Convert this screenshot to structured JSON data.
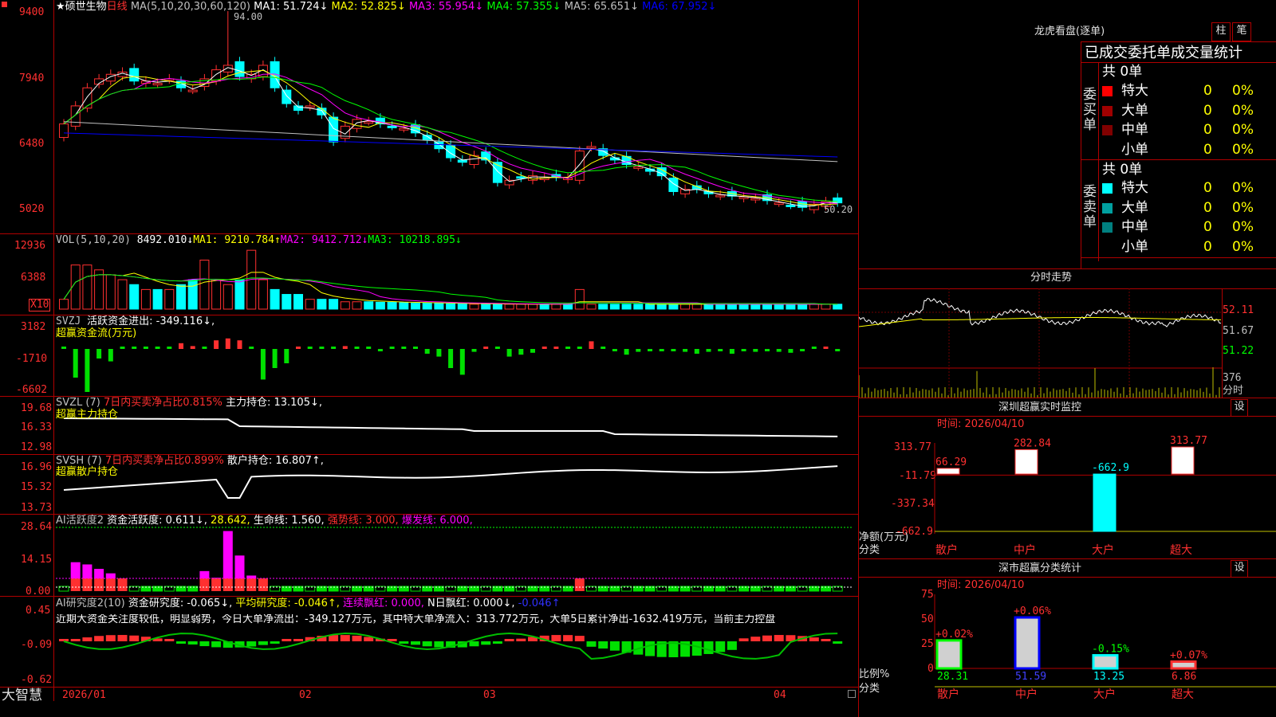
{
  "header": {
    "marker": "★",
    "stock_name": "硕世生物",
    "period": "日线",
    "ma_label": "MA(5,10,20,30,60,120)",
    "ma_values": [
      {
        "label": "MA1: 51.724↓",
        "color": "#ffffff"
      },
      {
        "label": "MA2: 52.825↓",
        "color": "#ffff00"
      },
      {
        "label": "MA3: 55.954↓",
        "color": "#ff00ff"
      },
      {
        "label": "MA4: 57.355↓",
        "color": "#00ff00"
      },
      {
        "label": "MA5: 65.651↓",
        "color": "#c0c0c0"
      },
      {
        "label": "MA6: 67.952↓",
        "color": "#0000ff"
      }
    ],
    "high_mark": "94.00",
    "low_mark": "50.20"
  },
  "price_axis": [
    "9400",
    "7940",
    "6480",
    "5020"
  ],
  "vol_panel": {
    "label": "VOL(5,10,20)",
    "v": "8492.010↓",
    "ma1": "MA1: 9210.784↑",
    "ma2": "MA2: 9412.712↓",
    "ma3": "MA3: 10218.895↓",
    "axis": [
      "12936",
      "6388"
    ],
    "unit": "X10"
  },
  "svzj_panel": {
    "label": "SVZJ",
    "text": "活跃资金进出: -349.116↓,",
    "sub": "超赢资金流(万元)",
    "axis": [
      "3182",
      "-1710",
      "-6602"
    ]
  },
  "svzl_panel": {
    "label": "SVZL (7)",
    "text1": "7日内买卖净占比0.815%",
    "text2": "主力持仓: 13.105↓,",
    "sub": "超赢主力持仓",
    "axis": [
      "19.68",
      "16.33",
      "12.98"
    ]
  },
  "svsh_panel": {
    "label": "SVSH (7)",
    "text1": "7日内买卖净占比0.899%",
    "text2": "散户持仓: 16.807↑,",
    "sub": "超赢散户持仓",
    "axis": [
      "16.96",
      "15.32",
      "13.73"
    ]
  },
  "ai_active_panel": {
    "label": "AI活跃度2",
    "text1": "资金活跃度: 0.611↓,",
    "text2": "28.642,",
    "text3": "生命线: 1.560,",
    "text4": "强势线: 3.000,",
    "text5": "爆发线: 6.000,",
    "axis": [
      "28.64",
      "14.15",
      "0.00"
    ]
  },
  "ai_research_panel": {
    "label": "AI研究度2(10)",
    "text1": "资金研究度: -0.065↓,",
    "text2": "平均研究度: -0.046↑,",
    "text3": "连续飘红: 0.000,",
    "text4": "N日飘红: 0.000↓,",
    "text5": "-0.046↑",
    "comment": "近期大资金关注度较低，明显弱势，今日大单净流出：-349.127万元，其中特大单净流入：313.772万元，大单5日累计净出-1632.419万元，当前主力控盘",
    "axis": [
      "0.45",
      "-0.09",
      "-0.62"
    ]
  },
  "date_axis": [
    "2026/01",
    "02",
    "03",
    "04"
  ],
  "brand": "大智慧",
  "dragon": {
    "title": "龙虎看盘(逐单)",
    "btn1": "柱",
    "btn2": "笔",
    "tabs": "已成交委托单成交量统计",
    "buy_total": "共 0单",
    "buy_side": "委买单",
    "sell_total": "共 0单",
    "sell_side": "委卖单",
    "buy_rows": [
      {
        "name": "特大",
        "n": "0",
        "p": "0%",
        "color": "#ff0000"
      },
      {
        "name": "大单",
        "n": "0",
        "p": "0%",
        "color": "#a00000"
      },
      {
        "name": "中单",
        "n": "0",
        "p": "0%",
        "color": "#800000"
      },
      {
        "name": "小单",
        "n": "0",
        "p": "0%",
        "color": ""
      }
    ],
    "sell_rows": [
      {
        "name": "特大",
        "n": "0",
        "p": "0%",
        "color": "#00ffff"
      },
      {
        "name": "大单",
        "n": "0",
        "p": "0%",
        "color": "#00a0a0"
      },
      {
        "name": "中单",
        "n": "0",
        "p": "0%",
        "color": "#008080"
      },
      {
        "name": "小单",
        "n": "0",
        "p": "0%",
        "color": ""
      }
    ]
  },
  "intraday": {
    "title": "分时走势",
    "axis": [
      "52.11",
      "51.67",
      "51.22"
    ],
    "vol_axis": [
      "376",
      "分时"
    ]
  },
  "monitor": {
    "title": "深圳超赢实时监控",
    "btn": "设",
    "time": "时间: 2026/04/10",
    "axis": [
      "313.77",
      "-11.79",
      "-337.34",
      "-662.9"
    ],
    "ylabel": "净额(万元)",
    "xlabel": "分类",
    "categories": [
      "散户",
      "中户",
      "大户",
      "超大"
    ],
    "values": [
      66.29,
      282.84,
      -662.9,
      313.77
    ],
    "value_labels": [
      "66.29",
      "282.84",
      "-662.9",
      "313.77"
    ]
  },
  "classify": {
    "title": "深市超赢分类统计",
    "btn": "设",
    "time": "时间: 2026/04/10",
    "axis": [
      "75",
      "50",
      "25",
      "0"
    ],
    "ylabel": "比例%",
    "xlabel": "分类",
    "categories": [
      "散户",
      "中户",
      "大户",
      "超大"
    ],
    "values": [
      28.31,
      51.59,
      13.25,
      6.86
    ],
    "value_labels": [
      "28.31",
      "51.59",
      "13.25",
      "6.86"
    ],
    "changes": [
      "+0.02%",
      "+0.06%",
      "-0.15%",
      "+0.07%"
    ]
  },
  "colors": {
    "up": "#ff3030",
    "down": "#00ffff",
    "grid": "#b00000",
    "green": "#00ff00"
  }
}
